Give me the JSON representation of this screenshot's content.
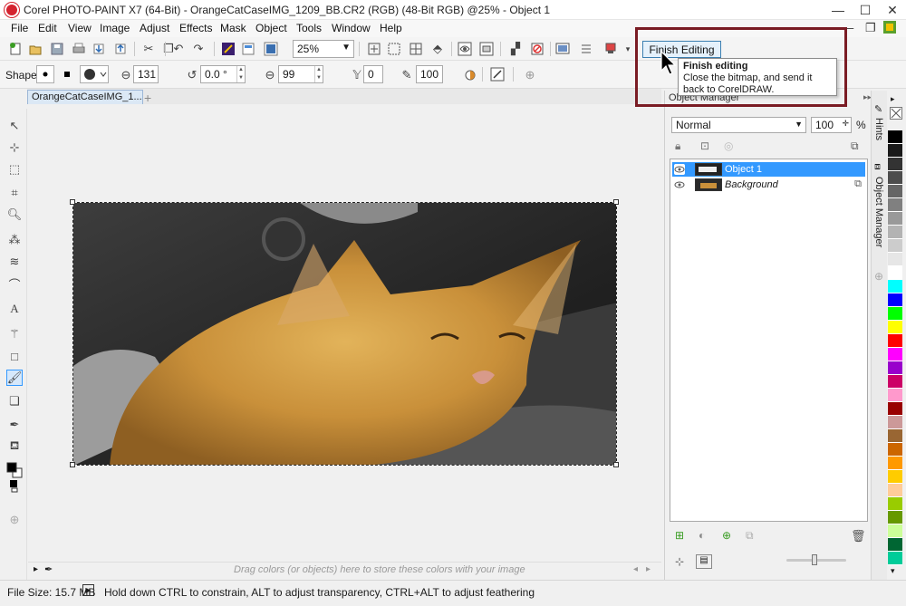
{
  "window": {
    "title": "Corel PHOTO-PAINT X7 (64-Bit) - OrangeCatCaseIMG_1209_BB.CR2 (RGB) (48-Bit RGB) @25% - Object 1",
    "minimize": "—",
    "maximize": "☐",
    "close": "✕"
  },
  "menu": {
    "items": [
      "File",
      "Edit",
      "View",
      "Image",
      "Adjust",
      "Effects",
      "Mask",
      "Object",
      "Tools",
      "Window",
      "Help"
    ]
  },
  "toolbar": {
    "zoom_value": "25%",
    "finish_label": "Finish Editing"
  },
  "tooltip": {
    "title": "Finish editing",
    "body": "Close the bitmap, and send it back to CorelDRAW."
  },
  "propbar": {
    "shape_label": "Shape:",
    "size": "131",
    "rotation": "0.0 °",
    "flatten": "99",
    "transparency": "0",
    "soft_edge": "100"
  },
  "document": {
    "tab_label": "OrangeCatCaseIMG_1..."
  },
  "palette_hint": "Drag colors (or objects) here to store these colors with your image",
  "status": {
    "file_size": "File Size: 15.7 MB",
    "hint": "Hold down CTRL to constrain, ALT to adjust transparency, CTRL+ALT to adjust feathering"
  },
  "object_manager": {
    "title": "Object Manager",
    "blend_mode": "Normal",
    "opacity": "100",
    "opacity_unit": "%",
    "layers": [
      {
        "name": "Object 1",
        "selected": true
      },
      {
        "name": "Background",
        "selected": false
      }
    ]
  },
  "dockers": {
    "hints_tab": "Hints",
    "om_tab": "Object Manager"
  },
  "colors": {
    "selection": "#3399ff",
    "highlight_frame": "#7a1c24",
    "palette": [
      "#000000",
      "#1a1a1a",
      "#333333",
      "#4d4d4d",
      "#666666",
      "#808080",
      "#999999",
      "#b3b3b3",
      "#cccccc",
      "#e6e6e6",
      "#ffffff",
      "#00ffff",
      "#0000ff",
      "#00ff00",
      "#ffff00",
      "#ff0000",
      "#ff00ff",
      "#9900cc",
      "#cc0066",
      "#ff99cc",
      "#990000",
      "#cc9999",
      "#996633",
      "#cc6600",
      "#ff9900",
      "#ffcc00",
      "#ffcc99",
      "#99cc00",
      "#669900",
      "#ccff99",
      "#006633",
      "#00cc99"
    ]
  }
}
